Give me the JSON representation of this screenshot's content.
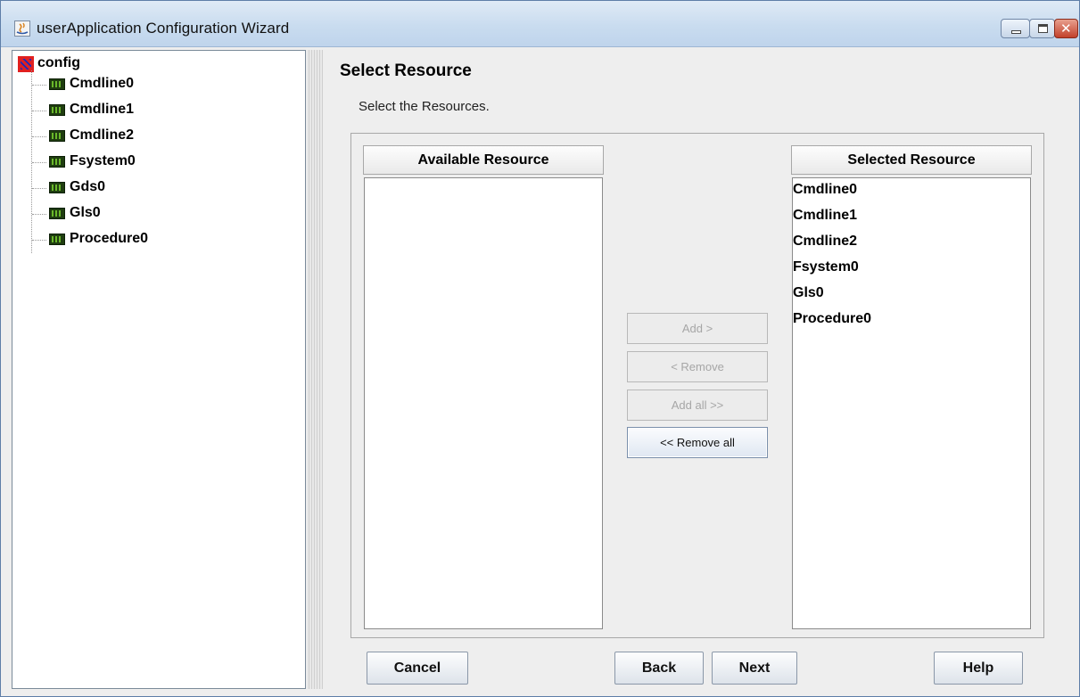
{
  "window": {
    "title": "userApplication Configuration Wizard"
  },
  "tree": {
    "root": "config",
    "items": [
      "Cmdline0",
      "Cmdline1",
      "Cmdline2",
      "Fsystem0",
      "Gds0",
      "Gls0",
      "Procedure0"
    ]
  },
  "page": {
    "title": "Select Resource",
    "subtitle": "Select the Resources."
  },
  "available": {
    "header": "Available Resource",
    "items": []
  },
  "selected": {
    "header": "Selected Resource",
    "items": [
      "Cmdline0",
      "Cmdline1",
      "Cmdline2",
      "Fsystem0",
      "Gls0",
      "Procedure0"
    ]
  },
  "transfer_buttons": {
    "add": "Add >",
    "remove": "< Remove",
    "add_all": "Add all >>",
    "remove_all": "<< Remove all"
  },
  "footer": {
    "cancel": "Cancel",
    "back": "Back",
    "next": "Next",
    "help": "Help"
  },
  "icons": {
    "app": "java-app-icon",
    "root": "config-icon",
    "resource": "resource-icon"
  }
}
